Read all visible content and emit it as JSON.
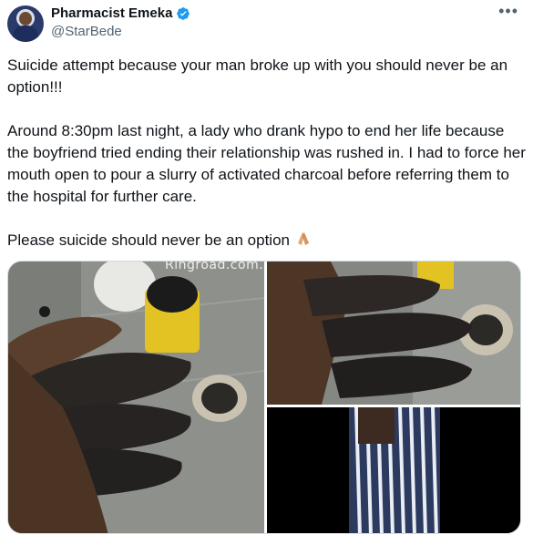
{
  "author": {
    "name": "Pharmacist Emeka",
    "handle": "@StarBede",
    "verified": true
  },
  "more_icon": "more-horizontal-icon",
  "tweet": {
    "para1": "Suicide attempt because your man broke up with you should never be an option!!!",
    "para2": "Around 8:30pm last night, a lady who drank hypo to end her life because the boyfriend tried ending their relationship was rushed in. I had to force her mouth open to pour a slurry of activated charcoal before referring them to the hospital for further care.",
    "para3": "Please suicide should never be an option",
    "para3_emoji": "folded-hands-emoji"
  },
  "media": {
    "watermark": "Ringroad.com.ng Free Adverts",
    "photos": [
      "charcoal-stained-hand-with-cups",
      "charcoal-stained-fingers-closeup",
      "patient-striped-clothing"
    ]
  },
  "colors": {
    "verified_blue": "#1d9bf0",
    "text_primary": "#0f1419",
    "text_secondary": "#536471"
  }
}
